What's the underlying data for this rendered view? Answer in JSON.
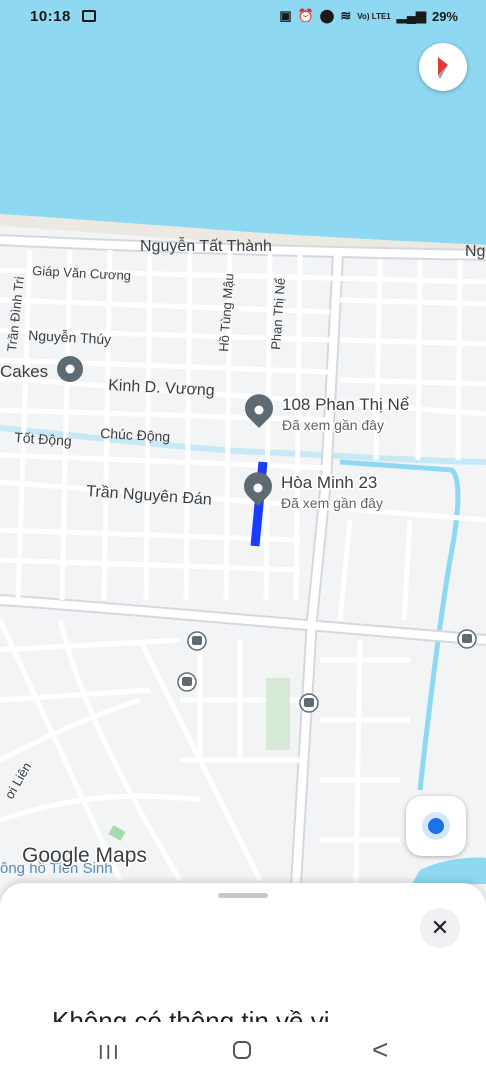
{
  "status_bar": {
    "time": "10:18",
    "image_icon": "image-icon",
    "indicators": [
      "battery-saver-icon",
      "alarm-icon",
      "location-icon",
      "wifi-icon",
      "volte-icon",
      "signal-icon"
    ],
    "volte_text": "Vo) LTE1",
    "battery": "29%"
  },
  "map": {
    "roads": [
      "Nguyễn Tất Thành",
      "Ng",
      "Giáp Văn Cương",
      "Trần Đình Tri",
      "Nguyễn Thúy",
      "Hồ Tùng Mậu",
      "Phan Thị Nể",
      "Kinh D. Vương",
      "Tốt Động",
      "Chúc Động",
      "Trần Nguyên Đán",
      "ơi Liên",
      "ông hồ Tiên Sinh"
    ],
    "business_fragment": "Cakes",
    "places": [
      {
        "name": "108 Phan Thị Nể",
        "note": "Đã xem gần đây"
      },
      {
        "name": "Hòa Minh 23",
        "note": "Đã xem gần đây"
      }
    ],
    "watermark": "Google Maps",
    "colors": {
      "water": "#8ed8f2",
      "road": "#ffffff",
      "land": "#f3f4f6",
      "route": "#1a3cff",
      "pin": "#5f6b73"
    }
  },
  "controls": {
    "compass_icon": "compass-icon",
    "locate_icon": "my-location-icon"
  },
  "sheet": {
    "close_icon": "close-icon",
    "close_glyph": "✕",
    "partial_text": "Không có thông tin về vị"
  },
  "nav_bar": {
    "recent_glyph": "III",
    "back_glyph": "<"
  }
}
